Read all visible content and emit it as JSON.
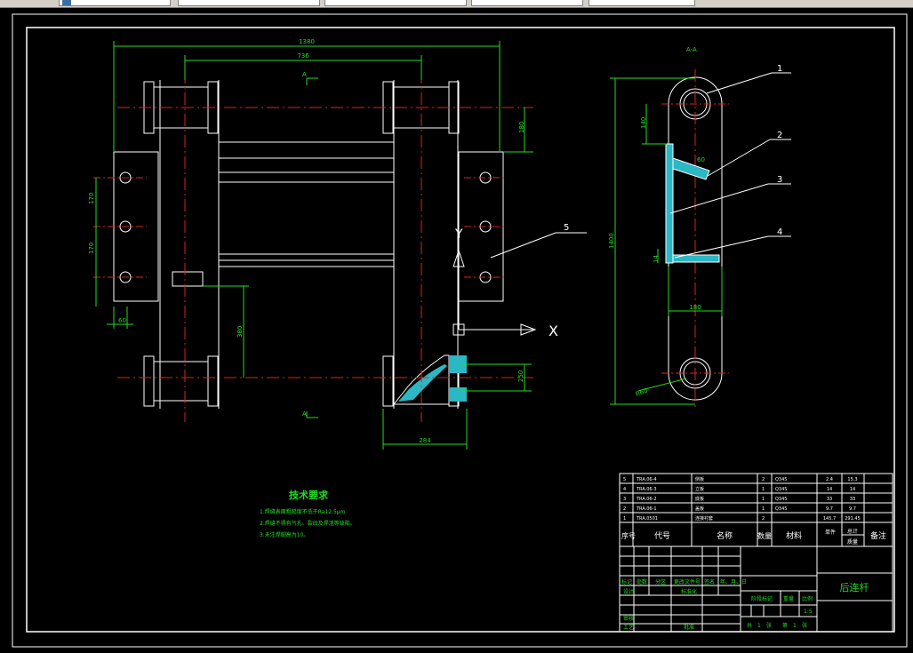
{
  "toolbar": {
    "fields": [
      "",
      "",
      "",
      "",
      ""
    ]
  },
  "drawing": {
    "main_view": {
      "dims": {
        "overall_width": "1380",
        "inner_width": "736",
        "right_height": "180",
        "hole_spacing_1": "170",
        "hole_spacing_2": "170",
        "left_bottom": "60",
        "center_to_bottom": "380",
        "bottom_right": "250",
        "bottom_width": "284"
      },
      "section_marks": [
        "A",
        "A"
      ],
      "part_callout": "5",
      "axes": {
        "y": "Y",
        "x": "X"
      }
    },
    "section_view": {
      "title": "A-A",
      "dims": {
        "top_offset": "140",
        "total_height": "1400",
        "web_width": "180",
        "radius": "R60",
        "angle": "60",
        "small": "14"
      },
      "callouts": [
        "1",
        "2",
        "3",
        "4"
      ]
    },
    "tech_requirements": {
      "title": "技术要求",
      "lines": [
        "1.焊缝表面粗糙度不低于Ra12.5μm",
        "2.焊缝不得有气孔、裂纹及焊渣等缺陷。",
        "3.未注焊脚高为10。"
      ]
    },
    "bom": {
      "rows": [
        {
          "no": "5",
          "code": "TRA.06-4",
          "name": "侧板",
          "qty": "2",
          "mat": "Q345",
          "w1": "2.4",
          "w2": "15.3"
        },
        {
          "no": "4",
          "code": "TRA.06-3",
          "name": "立板",
          "qty": "1",
          "mat": "Q345",
          "w1": "14",
          "w2": "14"
        },
        {
          "no": "3",
          "code": "TRA.06-2",
          "name": "底板",
          "qty": "1",
          "mat": "Q345",
          "w1": "33",
          "w2": "33"
        },
        {
          "no": "2",
          "code": "TRA.06-1",
          "name": "盖板",
          "qty": "1",
          "mat": "Q345",
          "w1": "9.7",
          "w2": "9.7"
        },
        {
          "no": "1",
          "code": "TRA.0501",
          "name": "连接衬套",
          "qty": "2",
          "mat": "",
          "w1": "145.7",
          "w2": "291.45"
        }
      ],
      "header": {
        "no": "序号",
        "code": "代号",
        "name": "名称",
        "qty": "数量",
        "mat": "材料",
        "unit": "单件",
        "total": "总计",
        "weight": "质量",
        "remark": "备注"
      }
    },
    "title_block": {
      "drawing_name": "后连杆",
      "scale": "1:5",
      "labels": {
        "mark": "标记",
        "count": "处数",
        "zone": "分区",
        "change_doc": "更改文件号",
        "sign": "签名",
        "ymd": "年、月、日",
        "design": "设计",
        "standard": "标准化",
        "stage_mark": "阶段标记",
        "weight": "重量",
        "scale_label": "比例",
        "review": "审核",
        "process": "工艺",
        "approve": "批准",
        "sheet_total": "共",
        "sheet_unit": "张",
        "sheet_no": "第",
        "sheet_unit2": "张",
        "sheet_count": "1",
        "sheet_current": "1"
      }
    }
  }
}
